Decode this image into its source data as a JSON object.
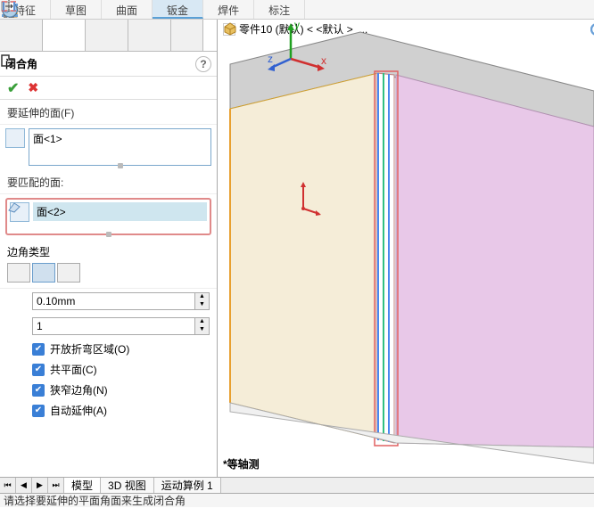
{
  "menu": {
    "tabs": [
      "特征",
      "草图",
      "曲面",
      "钣金",
      "焊件",
      "标注"
    ],
    "active_index": 3
  },
  "panel": {
    "title": "闭合角",
    "faces_to_extend": {
      "label": "要延伸的面(F)",
      "items": [
        "面<1>"
      ]
    },
    "faces_to_match": {
      "label": "要匹配的面:",
      "items": [
        "面<2>"
      ]
    },
    "corner_type": {
      "label": "边角类型",
      "selected_index": 1
    },
    "gap": {
      "value": "0.10mm"
    },
    "ratio": {
      "value": "1"
    },
    "checks": [
      {
        "label": "开放折弯区域(O)",
        "checked": true
      },
      {
        "label": "共平面(C)",
        "checked": true
      },
      {
        "label": "狭窄边角(N)",
        "checked": true
      },
      {
        "label": "自动延伸(A)",
        "checked": true
      }
    ]
  },
  "viewport": {
    "part_name": "零件10 (默认) < <默认 >_...",
    "view_label": "*等轴测",
    "axes": {
      "x": "x",
      "y": "y",
      "z": "z"
    }
  },
  "bottom_tabs": {
    "items": [
      "模型",
      "3D 视图",
      "运动算例 1"
    ],
    "active_index": 0
  },
  "status": "请选择要延伸的平面角面来生成闭合角"
}
